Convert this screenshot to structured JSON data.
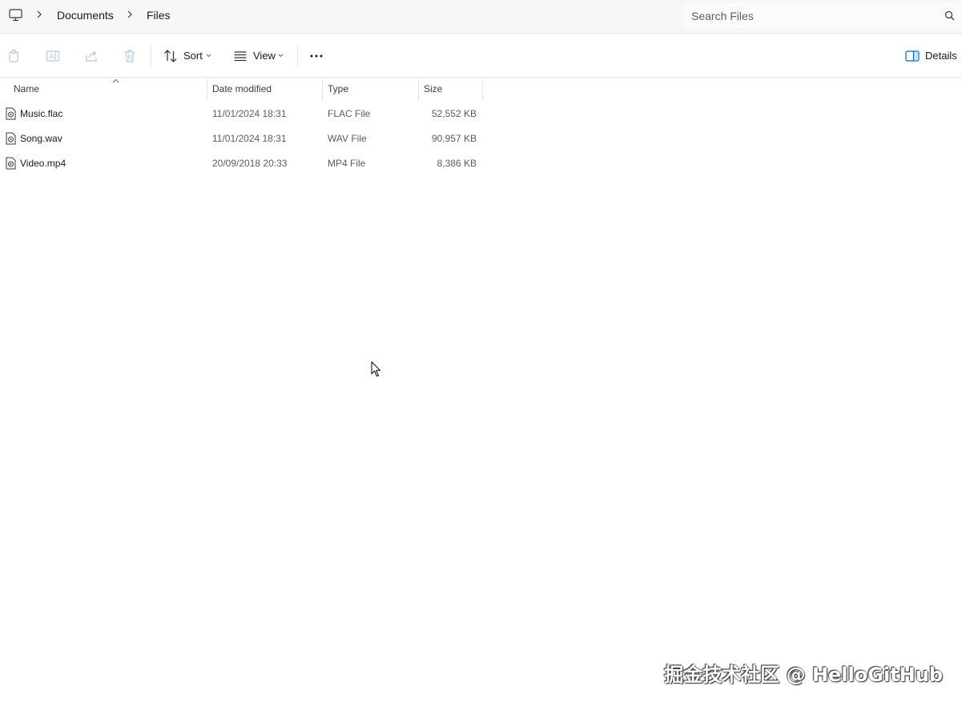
{
  "breadcrumb": {
    "items": [
      "Documents",
      "Files"
    ]
  },
  "search": {
    "placeholder": "Search Files"
  },
  "toolbar": {
    "sort_label": "Sort",
    "view_label": "View",
    "details_label": "Details",
    "icons": [
      "copy-icon",
      "rename-icon",
      "share-icon",
      "delete-icon",
      "sort-icon",
      "view-icon",
      "more-icon",
      "details-pane-icon"
    ]
  },
  "columns": {
    "name": "Name",
    "date": "Date modified",
    "type": "Type",
    "size": "Size",
    "sorted_by": "Name",
    "sort_direction": "ascending"
  },
  "files": [
    {
      "name": "Music.flac",
      "date": "11/01/2024 18:31",
      "type": "FLAC File",
      "size": "52,552 KB"
    },
    {
      "name": "Song.wav",
      "date": "11/01/2024 18:31",
      "type": "WAV File",
      "size": "90,957 KB"
    },
    {
      "name": "Video.mp4",
      "date": "20/09/2018 20:33",
      "type": "MP4 File",
      "size": "8,386 KB"
    }
  ],
  "watermark": "掘金技术社区 @ HelloGitHub",
  "colors": {
    "accent": "#0067c0",
    "text": "#1a1a1a",
    "muted": "#5c5c5c"
  }
}
